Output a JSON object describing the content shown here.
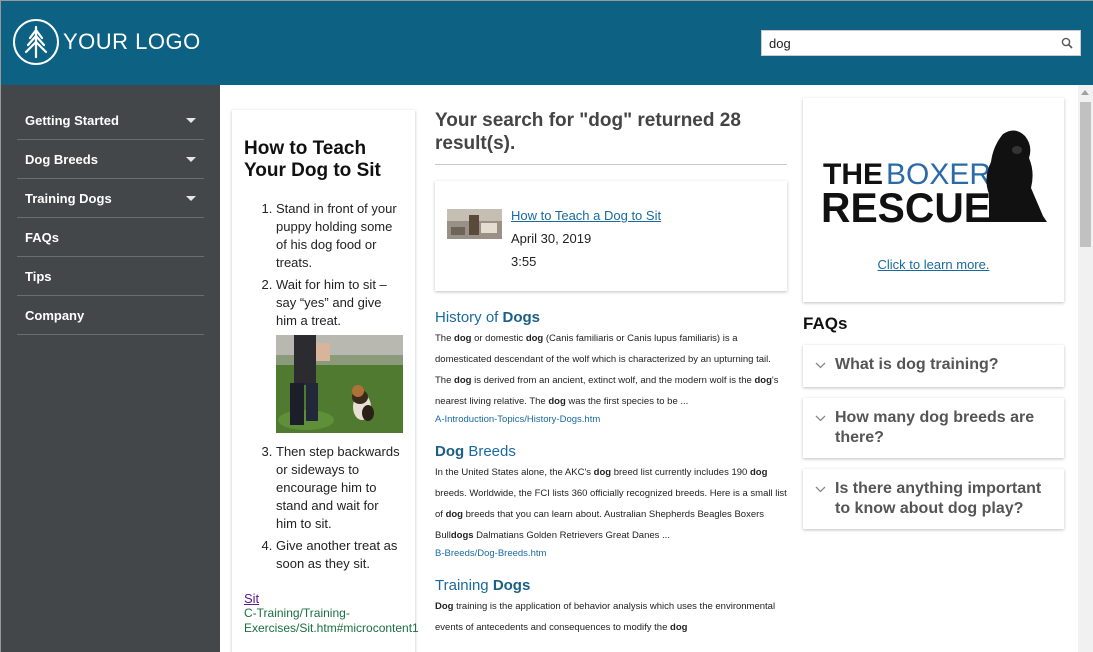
{
  "header": {
    "logo_text": "YOUR LOGO",
    "search_value": "dog",
    "brand_color": "#0d6284"
  },
  "sidebar": {
    "items": [
      {
        "label": "Getting Started",
        "has_dropdown": true
      },
      {
        "label": "Dog Breeds",
        "has_dropdown": true
      },
      {
        "label": "Training Dogs",
        "has_dropdown": true
      },
      {
        "label": "FAQs",
        "has_dropdown": false
      },
      {
        "label": "Tips",
        "has_dropdown": false
      },
      {
        "label": "Company",
        "has_dropdown": false
      }
    ]
  },
  "left_card": {
    "title": "How to Teach Your Dog to Sit",
    "steps": [
      "Stand in front of your puppy holding some of his dog food or treats.",
      "Wait for him to sit – say “yes” and give him a treat.",
      "Then step backwards or sideways to encourage him to stand and wait for him to sit.",
      "Give another treat as soon as they sit."
    ],
    "link": "Sit",
    "path": "C-Training/Training-Exercises/Sit.htm#microcontent1"
  },
  "results": {
    "heading": "Your search for \"dog\" returned 28 result(s).",
    "video": {
      "title": "How to Teach a Dog to Sit",
      "date": "April 30, 2019",
      "duration": "3:55"
    },
    "items": [
      {
        "title_pre": "History of ",
        "title_bold": "Dogs",
        "title_post": "",
        "snippet_html": "The <b>dog</b> or domestic <b>dog</b> (Canis familiaris or Canis lupus familiaris) is a domesticated descendant of the wolf which is characterized by an upturning tail. The <b>dog</b> is derived from an ancient, extinct wolf, and the modern wolf is the <b>dog</b>'s nearest living relative. The <b>dog</b> was the first species to be ...",
        "url": "A-Introduction-Topics/History-Dogs.htm"
      },
      {
        "title_pre": "",
        "title_bold": "Dog",
        "title_post": " Breeds",
        "snippet_html": "In the United States alone, the AKC's <b>dog</b> breed list currently includes 190 <b>dog</b> breeds. Worldwide, the FCI lists 360 officially recognized breeds. Here is a small list of <b>dog</b> breeds that you can learn about. Australian Shepherds Beagles Boxers Bull<b>dogs</b> Dalmatians Golden Retrievers Great Danes ...",
        "url": "B-Breeds/Dog-Breeds.htm"
      },
      {
        "title_pre": "Training ",
        "title_bold": "Dogs",
        "title_post": "",
        "snippet_html": "<b>Dog</b> training is the application of behavior analysis which uses the environmental events of antecedents and consequences to modify the <b>dog</b>",
        "url": ""
      }
    ]
  },
  "ad": {
    "logo_text_the": "THE",
    "logo_text_boxer": "BOXER",
    "logo_text_rescue": "RESCUE",
    "link": "Click to learn more."
  },
  "faqs": {
    "title": "FAQs",
    "items": [
      "What is dog training?",
      "How many dog breeds are there?",
      "Is there anything important to know about dog play?"
    ]
  }
}
